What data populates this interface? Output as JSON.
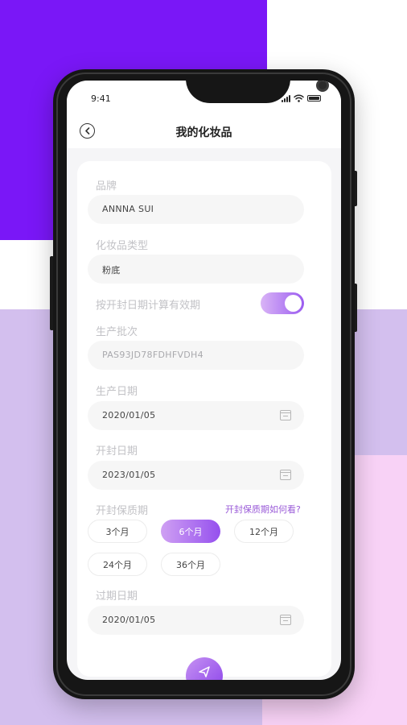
{
  "status_bar": {
    "time": "9:41"
  },
  "header": {
    "title": "我的化妆品"
  },
  "form": {
    "brand_label": "品牌",
    "brand_value": "ANNNA SUI",
    "type_label": "化妆品类型",
    "type_value": "粉底",
    "toggle_label": "按开封日期计算有效期",
    "toggle_on": true,
    "batch_label": "生产批次",
    "batch_placeholder": "PAS93JD78FDHFVDH4",
    "production_date_label": "生产日期",
    "production_date_value": "2020/01/05",
    "open_date_label": "开封日期",
    "open_date_value": "2023/01/05",
    "shelf_life_label": "开封保质期",
    "shelf_life_help": "开封保质期如何看?",
    "shelf_life_options": [
      "3个月",
      "6个月",
      "12个月",
      "24个月",
      "36个月"
    ],
    "shelf_life_selected": "6个月",
    "expiry_label": "过期日期",
    "expiry_value": "2020/01/05"
  },
  "colors": {
    "background_purple": "#7a17f7",
    "background_lavender": "#d3bfee",
    "background_pink": "#f8d2f6",
    "accent_start": "#cfa0f3",
    "accent_end": "#9550ee",
    "link": "#9a5bd8"
  },
  "icons": {
    "back": "back-icon",
    "calendar": "calendar-icon",
    "submit": "send-icon"
  }
}
